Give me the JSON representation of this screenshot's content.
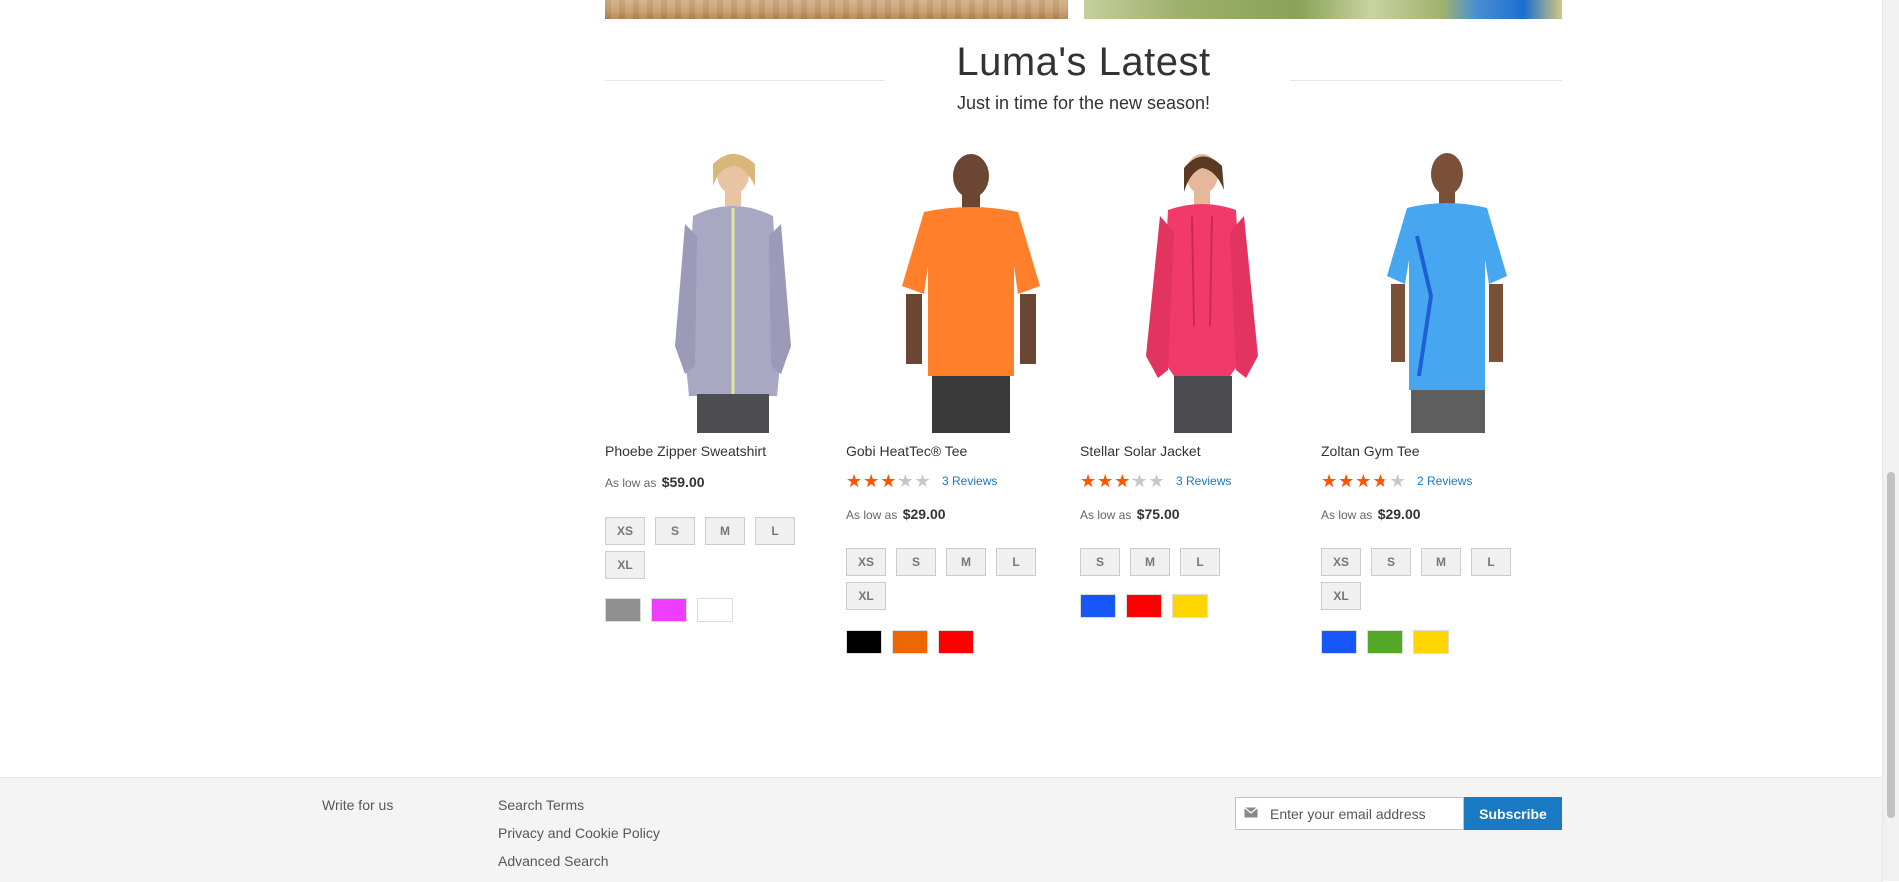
{
  "section": {
    "title": "Luma's Latest",
    "subtitle": "Just in time for the new season!"
  },
  "products": [
    {
      "name": "Phoebe Zipper Sweatshirt",
      "price_prefix": "As low as",
      "price": "$59.00",
      "sizes": [
        "XS",
        "S",
        "M",
        "L",
        "XL"
      ],
      "colors": [
        "#8f8f8f",
        "#ef3dff",
        "#ffffff"
      ]
    },
    {
      "name": "Gobi HeatTec® Tee",
      "rating_percent": 60,
      "reviews": "3 Reviews",
      "price_prefix": "As low as",
      "price": "$29.00",
      "sizes": [
        "XS",
        "S",
        "M",
        "L",
        "XL"
      ],
      "colors": [
        "#000000",
        "#eb6703",
        "#ff0000"
      ]
    },
    {
      "name": "Stellar Solar Jacket",
      "rating_percent": 60,
      "reviews": "3 Reviews",
      "price_prefix": "As low as",
      "price": "$75.00",
      "sizes": [
        "S",
        "M",
        "L"
      ],
      "colors": [
        "#1857f7",
        "#ff0000",
        "#ffd500"
      ]
    },
    {
      "name": "Zoltan Gym Tee",
      "rating_percent": 70,
      "reviews": "2 Reviews",
      "price_prefix": "As low as",
      "price": "$29.00",
      "sizes": [
        "XS",
        "S",
        "M",
        "L",
        "XL"
      ],
      "colors": [
        "#1857f7",
        "#53a828",
        "#ffd500"
      ]
    }
  ],
  "footer": {
    "links_col1": [
      "Write for us"
    ],
    "links_col2": [
      "Search Terms",
      "Privacy and Cookie Policy",
      "Advanced Search"
    ],
    "newsletter_placeholder": "Enter your email address",
    "subscribe_label": "Subscribe"
  },
  "colors": {
    "accent": "#1979c3",
    "star": "#ff5501"
  }
}
